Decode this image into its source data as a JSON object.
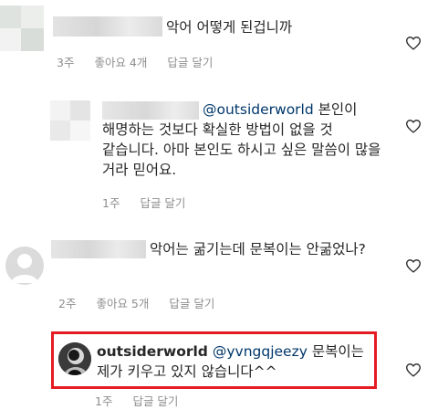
{
  "comments": [
    {
      "text": "악어 어떻게 된겁니까",
      "time": "3주",
      "likes": "좋아요 4개",
      "reply": "답글 달기"
    },
    {
      "mention": "@outsiderworld",
      "text": " 본인이 해명하는 것보다 확실한 방법이 없을 것 같습니다. 아마 본인도 하시고 싶은 말씀이 많을 거라 믿어요.",
      "time": "1주",
      "reply": "답글 달기"
    },
    {
      "text": "악어는 굶기는데 문복이는 안굶었나?",
      "time": "2주",
      "likes": "좋아요 5개",
      "reply": "답글 달기"
    },
    {
      "username": "outsiderworld",
      "mention": "@yvngqjeezy",
      "text": " 문복이는 제가 키우고 있지 않습니다^^",
      "time": "1주",
      "reply": "답글 달기"
    }
  ],
  "icons": {
    "like": "heart-outline-icon"
  },
  "colors": {
    "highlight": "#e51c23",
    "mention": "#00376b",
    "meta": "#8e8e8e"
  }
}
